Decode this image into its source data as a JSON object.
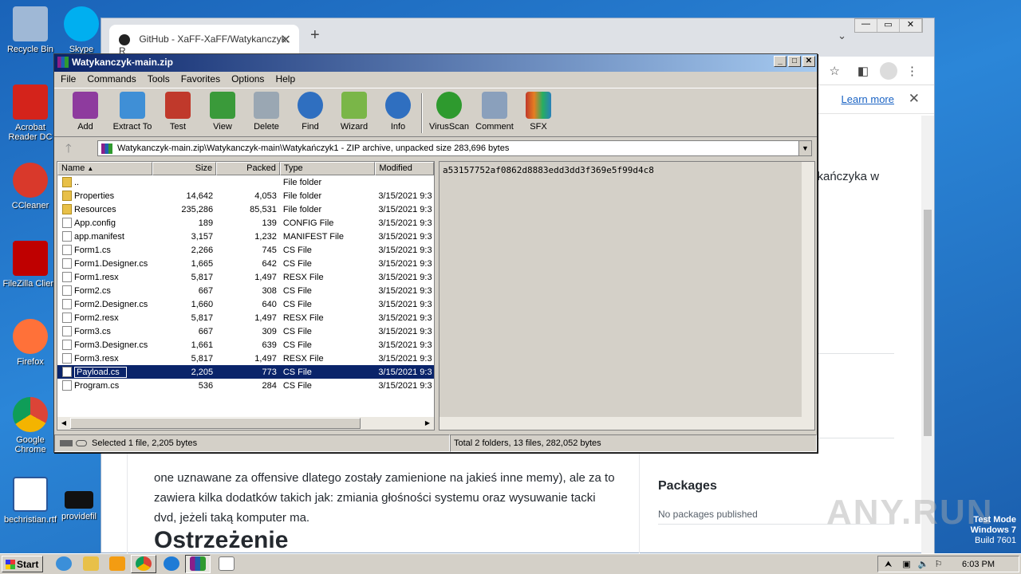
{
  "desktop": {
    "icons": [
      {
        "label": "Recycle Bin",
        "icon": "recycle-bin-icon",
        "color": "#9fb8d6"
      },
      {
        "label": "Skype",
        "icon": "skype-icon",
        "color": "#00aff0"
      },
      {
        "label": "Acrobat Reader DC",
        "icon": "acrobat-icon",
        "color": "#d4231b"
      },
      {
        "label": "CCleaner",
        "icon": "ccleaner-icon",
        "color": "#d9392b"
      },
      {
        "label": "FileZilla Client",
        "icon": "filezilla-icon",
        "color": "#bf0000"
      },
      {
        "label": "Firefox",
        "icon": "firefox-icon",
        "color": "#ff7139"
      },
      {
        "label": "Google Chrome",
        "icon": "chrome-icon",
        "color": "#4285f4"
      },
      {
        "label": "bechristian.rtf",
        "icon": "word-doc-icon",
        "color": "#2b579a"
      },
      {
        "label": "providefil",
        "icon": "file-icon",
        "color": "#111111"
      }
    ]
  },
  "browser": {
    "tab_title": "GitHub - XaFF-XaFF/Watykanczyk: R",
    "learn_more": "Learn more",
    "page_fragment": "ykańczyka w",
    "paragraph": "one uznawane za offensive dlatego zostały zamienione na jakieś inne memy), ale za to zawiera kilka dodatków takich jak: zmiania głośności systemu oraz wysuwanie tacki dvd, jeżeli taką komputer ma.",
    "heading": "Ostrzeżenie",
    "packages_title": "Packages",
    "packages_text": "No packages published"
  },
  "winrar": {
    "title": "Watykanczyk-main.zip",
    "menu": [
      "File",
      "Commands",
      "Tools",
      "Favorites",
      "Options",
      "Help"
    ],
    "toolbar": [
      {
        "label": "Add",
        "icon": "add-archive-icon",
        "color": "#8e3b9e"
      },
      {
        "label": "Extract To",
        "icon": "extract-folder-icon",
        "color": "#3f8fd6"
      },
      {
        "label": "Test",
        "icon": "test-checklist-icon",
        "color": "#c0392b"
      },
      {
        "label": "View",
        "icon": "view-book-icon",
        "color": "#3a9a3a"
      },
      {
        "label": "Delete",
        "icon": "delete-trash-icon",
        "color": "#9aa7b3"
      },
      {
        "label": "Find",
        "icon": "find-magnifier-icon",
        "color": "#2f6fc0"
      },
      {
        "label": "Wizard",
        "icon": "wizard-wand-icon",
        "color": "#7ab648"
      },
      {
        "label": "Info",
        "icon": "info-icon",
        "color": "#2f6fc0"
      },
      {
        "label": "VirusScan",
        "icon": "virus-scan-icon",
        "color": "#2e9a2e"
      },
      {
        "label": "Comment",
        "icon": "comment-icon",
        "color": "#8aa0bc"
      },
      {
        "label": "SFX",
        "icon": "sfx-icon",
        "color": "#c0392b"
      }
    ],
    "path": "Watykanczyk-main.zip\\Watykanczyk-main\\Watykańczyk1 - ZIP archive, unpacked size 283,696 bytes",
    "columns": {
      "name": "Name",
      "size": "Size",
      "packed": "Packed",
      "type": "Type",
      "modified": "Modified"
    },
    "files": [
      {
        "name": "..",
        "size": "",
        "packed": "",
        "type": "File folder",
        "modified": "",
        "kind": "folder"
      },
      {
        "name": "Properties",
        "size": "14,642",
        "packed": "4,053",
        "type": "File folder",
        "modified": "3/15/2021 9:3",
        "kind": "folder"
      },
      {
        "name": "Resources",
        "size": "235,286",
        "packed": "85,531",
        "type": "File folder",
        "modified": "3/15/2021 9:3",
        "kind": "folder"
      },
      {
        "name": "App.config",
        "size": "189",
        "packed": "139",
        "type": "CONFIG File",
        "modified": "3/15/2021 9:3",
        "kind": "file"
      },
      {
        "name": "app.manifest",
        "size": "3,157",
        "packed": "1,232",
        "type": "MANIFEST File",
        "modified": "3/15/2021 9:3",
        "kind": "file"
      },
      {
        "name": "Form1.cs",
        "size": "2,266",
        "packed": "745",
        "type": "CS File",
        "modified": "3/15/2021 9:3",
        "kind": "file"
      },
      {
        "name": "Form1.Designer.cs",
        "size": "1,665",
        "packed": "642",
        "type": "CS File",
        "modified": "3/15/2021 9:3",
        "kind": "file"
      },
      {
        "name": "Form1.resx",
        "size": "5,817",
        "packed": "1,497",
        "type": "RESX File",
        "modified": "3/15/2021 9:3",
        "kind": "file"
      },
      {
        "name": "Form2.cs",
        "size": "667",
        "packed": "308",
        "type": "CS File",
        "modified": "3/15/2021 9:3",
        "kind": "file"
      },
      {
        "name": "Form2.Designer.cs",
        "size": "1,660",
        "packed": "640",
        "type": "CS File",
        "modified": "3/15/2021 9:3",
        "kind": "file"
      },
      {
        "name": "Form2.resx",
        "size": "5,817",
        "packed": "1,497",
        "type": "RESX File",
        "modified": "3/15/2021 9:3",
        "kind": "file"
      },
      {
        "name": "Form3.cs",
        "size": "667",
        "packed": "309",
        "type": "CS File",
        "modified": "3/15/2021 9:3",
        "kind": "file"
      },
      {
        "name": "Form3.Designer.cs",
        "size": "1,661",
        "packed": "639",
        "type": "CS File",
        "modified": "3/15/2021 9:3",
        "kind": "file"
      },
      {
        "name": "Form3.resx",
        "size": "5,817",
        "packed": "1,497",
        "type": "RESX File",
        "modified": "3/15/2021 9:3",
        "kind": "file"
      },
      {
        "name": "Payload.cs",
        "size": "2,205",
        "packed": "773",
        "type": "CS File",
        "modified": "3/15/2021 9:3",
        "kind": "file",
        "selected": true
      },
      {
        "name": "Program.cs",
        "size": "536",
        "packed": "284",
        "type": "CS File",
        "modified": "3/15/2021 9:3",
        "kind": "file"
      }
    ],
    "comment": "a53157752af0862d8883edd3dd3f369e5f99d4c8",
    "status_left": "Selected 1 file, 2,205 bytes",
    "status_right": "Total 2 folders, 13 files, 282,052 bytes"
  },
  "taskbar": {
    "start": "Start",
    "clock": "6:03 PM"
  },
  "watermark": {
    "line1": "Test Mode",
    "line2": "Windows 7",
    "line3": "Build 7601",
    "brand": "ANY.RUN"
  }
}
